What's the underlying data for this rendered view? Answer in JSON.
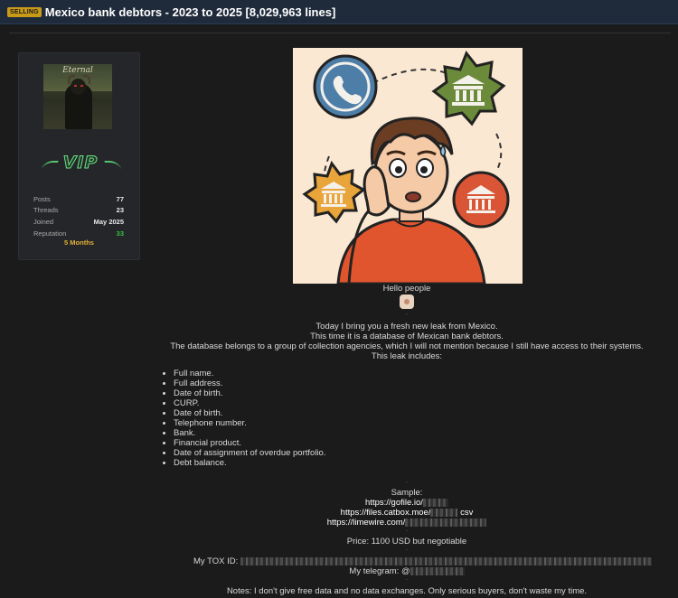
{
  "thread": {
    "badge": "SELLING",
    "title": "Mexico bank debtors - 2023 to 2025 [8,029,963 lines]"
  },
  "user": {
    "avatar_text": "Eternal",
    "rank_badge": "VIP",
    "stats": [
      {
        "label": "Posts",
        "value": "77"
      },
      {
        "label": "Threads",
        "value": "23"
      },
      {
        "label": "Joined",
        "value": "May 2025"
      },
      {
        "label": "Reputation",
        "value": "33"
      }
    ],
    "membership": "5 Months",
    "reputation_color": "#36c043"
  },
  "post": {
    "greeting": "Hello people",
    "intro_lines": [
      "Today I bring you a fresh new leak from Mexico.",
      "This time it is a database of Mexican bank debtors.",
      "The database belongs to a group of collection agencies, which I will not mention because I still have access to their systems.",
      "This leak includes:"
    ],
    "features": [
      "Full name.",
      "Full address.",
      "Date of birth.",
      "CURP.",
      "Date of birth.",
      "Telephone number.",
      "Bank.",
      "Financial product.",
      "Date of assignment of overdue portfolio.",
      "Debt balance."
    ],
    "sample_label": "Sample:",
    "sample_links": [
      "https://gofile.io/",
      "https://files.catbox.moe/",
      "https://limewire.com/"
    ],
    "sample_suffix": "csv",
    "price": "Price: 1100 USD but negotiable",
    "tox_label": "My TOX ID:",
    "telegram_label": "My telegram: @",
    "notes": "Notes: I don't give free data and no data exchanges. Only serious buyers, don't waste my time.",
    "separator_dash": "-"
  },
  "colors": {
    "topbar": "#1f2b3b",
    "badge": "#c99a17",
    "months": "#e3b237"
  }
}
